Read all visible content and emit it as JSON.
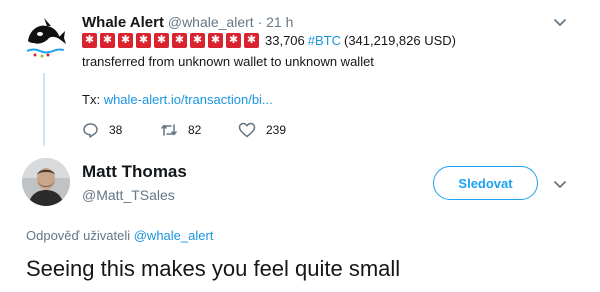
{
  "tweet1": {
    "author_name": "Whale Alert",
    "author_handle": "@whale_alert",
    "separator": "·",
    "time": "21 h",
    "alert_count": 10,
    "alert_glyph": "✱",
    "amount": "33,706",
    "hashtag": "#BTC",
    "usd": "(341,219,826 USD)",
    "text": "transferred from unknown wallet to unknown wallet",
    "tx_label": "Tx:",
    "tx_link": "whale-alert.io/transaction/bi...",
    "actions": {
      "replies": "38",
      "retweets": "82",
      "likes": "239"
    }
  },
  "tweet2": {
    "author_name": "Matt Thomas",
    "author_handle": "@Matt_TSales",
    "follow_label": "Sledovat",
    "reply_to_label": "Odpověď uživateli",
    "reply_to_handle": "@whale_alert",
    "text": "Seeing this makes you feel quite small"
  },
  "colors": {
    "accent": "#1da1f2",
    "link": "#1b95e0",
    "alert_red": "#d9232e",
    "muted": "#657786",
    "thread_line": "#cfe3f4"
  }
}
